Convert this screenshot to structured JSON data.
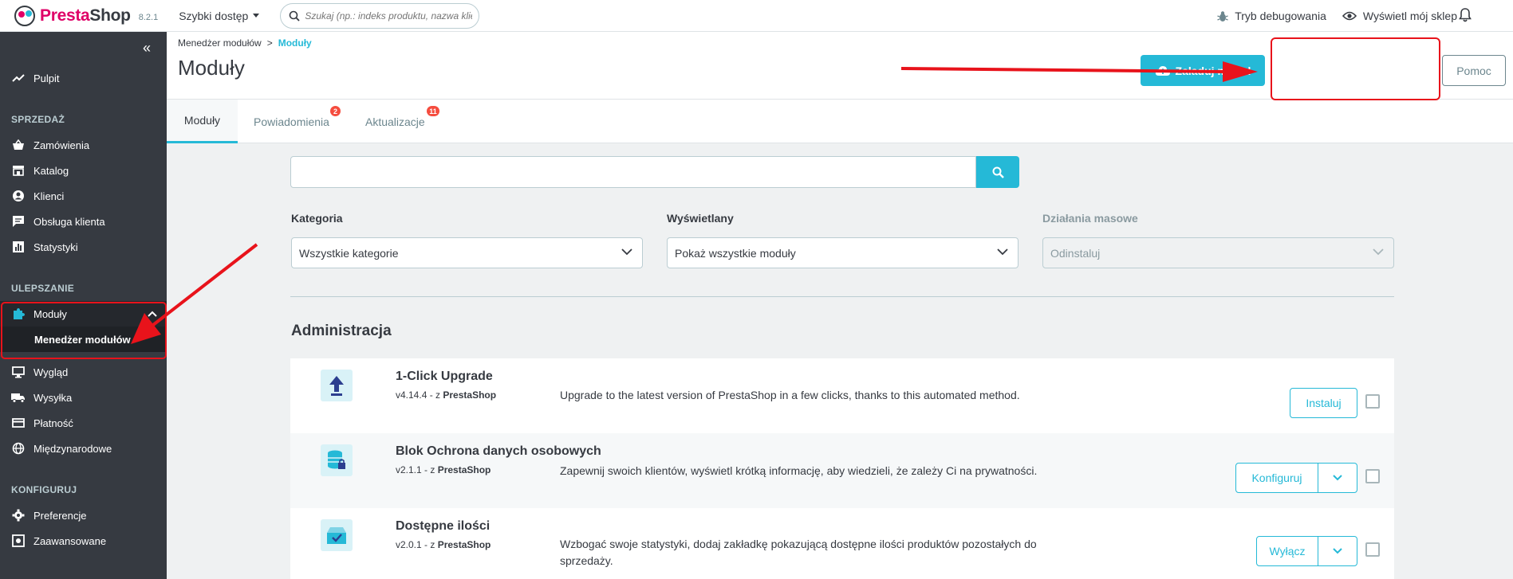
{
  "header": {
    "brand_first": "Presta",
    "brand_second": "Shop",
    "version": "8.2.1",
    "quick_access": "Szybki dostęp",
    "search_placeholder": "Szukaj (np.: indeks produktu, nazwa klienta...)",
    "debug_mode": "Tryb debugowania",
    "view_shop": "Wyświetl mój sklep"
  },
  "sidebar": {
    "dashboard": "Pulpit",
    "section_sell": "SPRZEDAŻ",
    "orders": "Zamówienia",
    "catalog": "Katalog",
    "customers": "Klienci",
    "customer_service": "Obsługa klienta",
    "stats": "Statystyki",
    "section_improve": "ULEPSZANIE",
    "modules": "Moduły",
    "module_manager": "Menedżer modułów",
    "design": "Wygląd",
    "shipping": "Wysyłka",
    "payment": "Płatność",
    "international": "Międzynarodowe",
    "section_configure": "KONFIGURUJ",
    "preferences": "Preferencje",
    "advanced": "Zaawansowane"
  },
  "page": {
    "breadcrumb_parent": "Menedżer modułów",
    "breadcrumb_sep": ">",
    "breadcrumb_current": "Moduły",
    "title": "Moduły",
    "upload_button": "Załaduj moduł",
    "help_button": "Pomoc"
  },
  "tabs": {
    "modules": "Moduły",
    "notifications": "Powiadomienia",
    "notifications_count": "2",
    "updates": "Aktualizacje",
    "updates_count": "11"
  },
  "filters": {
    "category_label": "Kategoria",
    "category_value": "Wszystkie kategorie",
    "status_label": "Wyświetlany",
    "status_value": "Pokaż wszystkie moduły",
    "bulk_label": "Działania masowe",
    "bulk_value": "Odinstaluj"
  },
  "section_title": "Administracja",
  "modules": [
    {
      "name": "1-Click Upgrade",
      "version": "v4.14.4 - z",
      "author": "PrestaShop",
      "description": "Upgrade to the latest version of PrestaShop in a few clicks, thanks to this automated method.",
      "action": "Instaluj",
      "icon": "upload-arrow-icon"
    },
    {
      "name": "Blok Ochrona danych osobowych",
      "version": "v2.1.1 - z",
      "author": "PrestaShop",
      "description": "Zapewnij swoich klientów, wyświetl krótką informację, aby wiedzieli, że zależy Ci na prywatności.",
      "action": "Konfiguruj",
      "icon": "database-lock-icon"
    },
    {
      "name": "Dostępne ilości",
      "version": "v2.0.1 - z",
      "author": "PrestaShop",
      "description": "Wzbogać swoje statystyki, dodaj zakładkę pokazującą dostępne ilości produktów pozostałych do sprzedaży.",
      "action": "Wyłącz",
      "icon": "box-check-icon"
    }
  ],
  "colors": {
    "brand_pink": "#df0067",
    "accent": "#25b9d7",
    "sidebar_bg": "#363a41",
    "annotation_red": "#e8131b"
  }
}
